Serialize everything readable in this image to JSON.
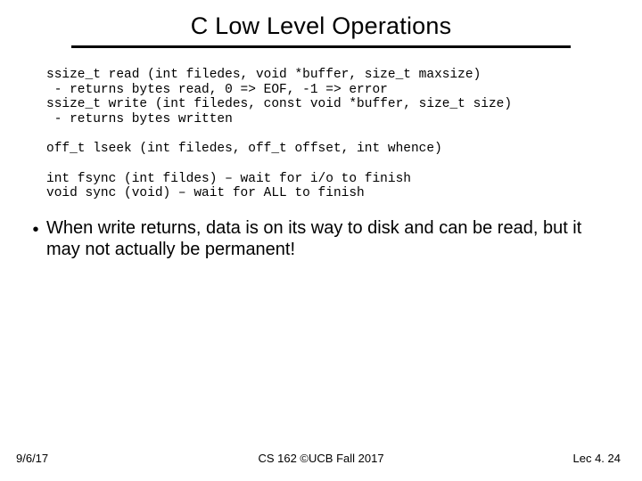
{
  "title": "C Low Level Operations",
  "code": "ssize_t read (int filedes, void *buffer, size_t maxsize)\n - returns bytes read, 0 => EOF, -1 => error\nssize_t write (int filedes, const void *buffer, size_t size)\n - returns bytes written\n\noff_t lseek (int filedes, off_t offset, int whence)\n\nint fsync (int fildes) – wait for i/o to finish\nvoid sync (void) – wait for ALL to finish",
  "bullet": "When write returns, data is on its way to disk and can be read, but it may not actually be permanent!",
  "footer": {
    "left": "9/6/17",
    "center": "CS 162 ©UCB Fall 2017",
    "right": "Lec 4. 24"
  }
}
